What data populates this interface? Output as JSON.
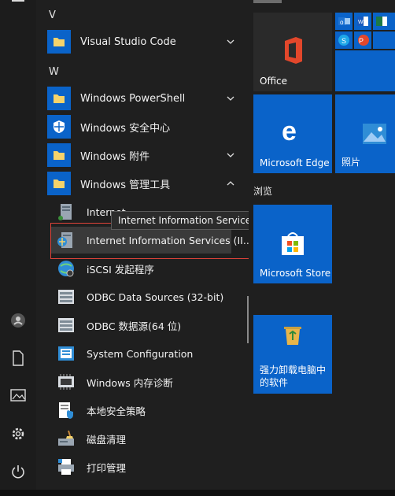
{
  "sections": {
    "v": "V",
    "w": "W"
  },
  "apps": {
    "vscode": "Visual Studio Code",
    "powershell": "Windows PowerShell",
    "security": "Windows 安全中心",
    "accessories": "Windows 附件",
    "admin_tools": "Windows 管理工具"
  },
  "admin_items": {
    "iis_partial": "Internet",
    "iis_selected": "Internet Information Services (II...",
    "iscsi": "iSCSI 发起程序",
    "odbc32": "ODBC Data Sources (32-bit)",
    "odbc64": "ODBC 数据源(64 位)",
    "sysconfig": "System Configuration",
    "memdiag": "Windows 内存诊断",
    "secpol": "本地安全策略",
    "diskclean": "磁盘清理",
    "printmgmt": "打印管理"
  },
  "tooltip": "Internet Information Services (IIS)管理器",
  "tiles": {
    "office": "Office",
    "edge": "Microsoft Edge",
    "photos": "照片",
    "browse_group": "浏览",
    "store": "Microsoft Store",
    "uninstall": "强力卸载电脑中的软件"
  },
  "colors": {
    "tile_blue": "#0a63c9",
    "highlight_red": "#e0433a"
  }
}
